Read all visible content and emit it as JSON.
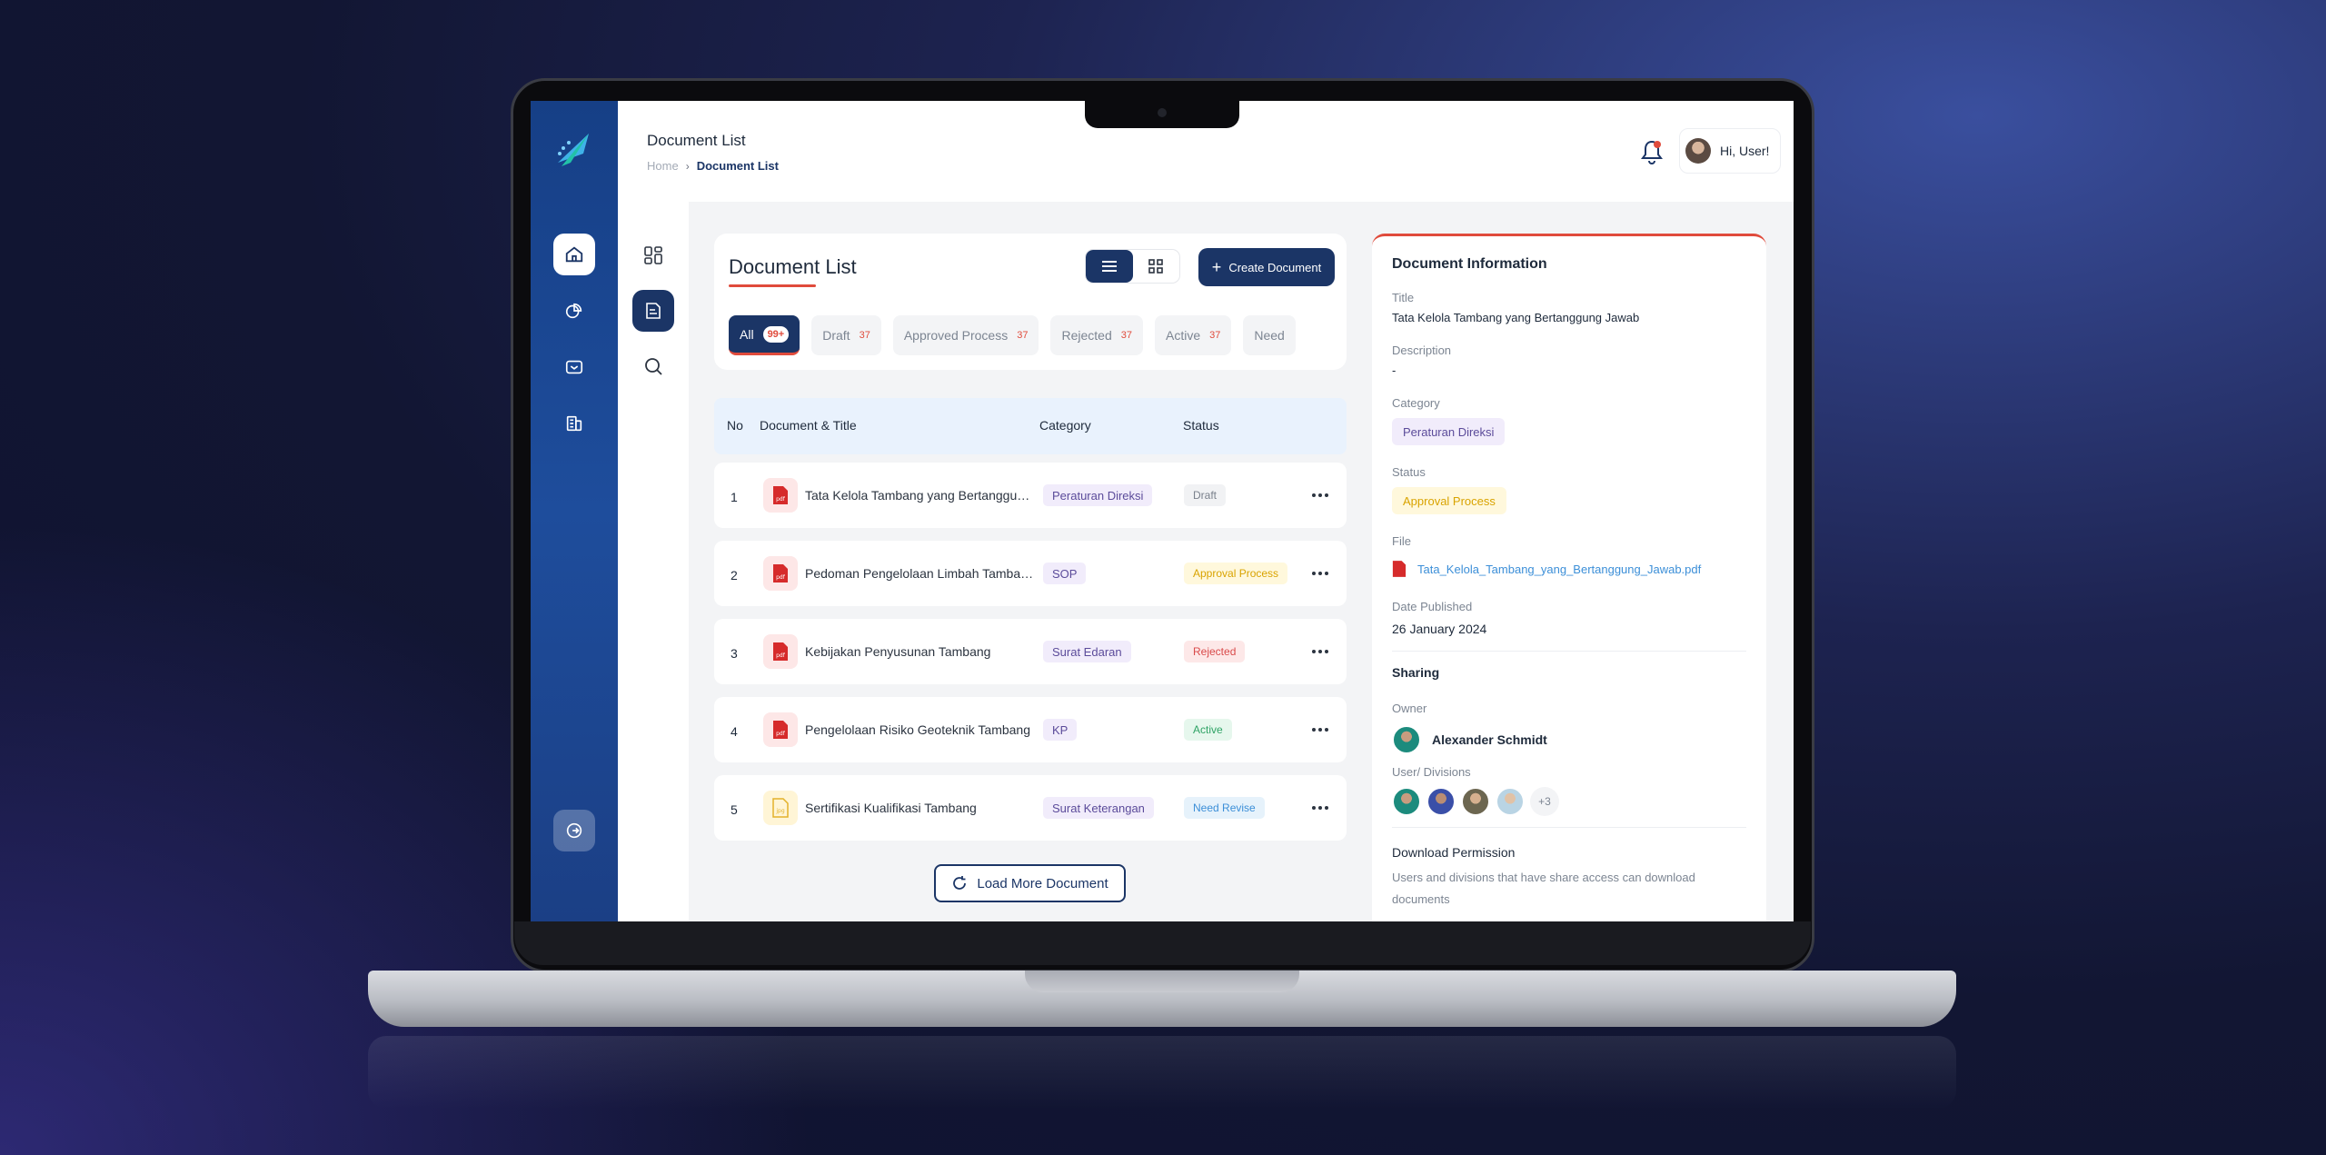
{
  "header": {
    "title": "Document List",
    "breadcrumb": {
      "home": "Home",
      "current": "Document List"
    },
    "greeting": "Hi, User!"
  },
  "list_card": {
    "title": "Document List",
    "create_label": "Create Document",
    "tabs": [
      {
        "label": "All",
        "count": "99+"
      },
      {
        "label": "Draft",
        "count": "37"
      },
      {
        "label": "Approved Process",
        "count": "37"
      },
      {
        "label": "Rejected",
        "count": "37"
      },
      {
        "label": "Active",
        "count": "37"
      },
      {
        "label": "Need",
        "count": ""
      }
    ]
  },
  "table": {
    "headers": {
      "no": "No",
      "doc": "Document & Title",
      "category": "Category",
      "status": "Status"
    },
    "rows": [
      {
        "no": "1",
        "title": "Tata Kelola Tambang yang Bertanggun...",
        "category": "Peraturan Direksi",
        "status": "Draft",
        "file_type": "pdf"
      },
      {
        "no": "2",
        "title": "Pedoman Pengelolaan Limbah Tambang",
        "category": "SOP",
        "status": "Approval Process",
        "file_type": "pdf"
      },
      {
        "no": "3",
        "title": "Kebijakan Penyusunan Tambang",
        "category": "Surat Edaran",
        "status": "Rejected",
        "file_type": "pdf"
      },
      {
        "no": "4",
        "title": "Pengelolaan Risiko Geoteknik Tambang",
        "category": "KP",
        "status": "Active",
        "file_type": "pdf"
      },
      {
        "no": "5",
        "title": "Sertifikasi Kualifikasi Tambang",
        "category": "Surat Keterangan",
        "status": "Need Revise",
        "file_type": "jpg"
      }
    ],
    "load_more": "Load More Document"
  },
  "info": {
    "title": "Document Information",
    "title_label": "Title",
    "title_value": "Tata Kelola Tambang yang Bertanggung Jawab",
    "description_label": "Description",
    "description_value": "-",
    "category_label": "Category",
    "category_value": "Peraturan Direksi",
    "status_label": "Status",
    "status_value": "Approval Process",
    "file_label": "File",
    "file_name": "Tata_Kelola_Tambang_yang_Bertanggung_Jawab.pdf",
    "date_label": "Date Published",
    "date_value": "26 January 2024",
    "sharing_title": "Sharing",
    "owner_label": "Owner",
    "owner_name": "Alexander Schmidt",
    "users_label": "User/ Divisions",
    "users_more": "+3",
    "permission_title": "Download Permission",
    "permission_desc": "Users and divisions that have share access can download documents"
  },
  "colors": {
    "primary": "#1b3566",
    "accent": "#e04b3c",
    "sidebar": "#1e4d9c",
    "table_header_bg": "#e9f2fd"
  },
  "icons": {
    "sidebar_primary": [
      "home-icon",
      "documents-icon",
      "inbox-icon",
      "building-icon"
    ],
    "sidebar_secondary": [
      "grid-icon",
      "document-icon",
      "search-icon"
    ],
    "other": [
      "logout-icon",
      "bell-icon",
      "list-view-icon",
      "grid-view-icon",
      "plus-icon",
      "refresh-icon",
      "pdf-file-icon",
      "jpg-file-icon",
      "more-icon"
    ]
  }
}
